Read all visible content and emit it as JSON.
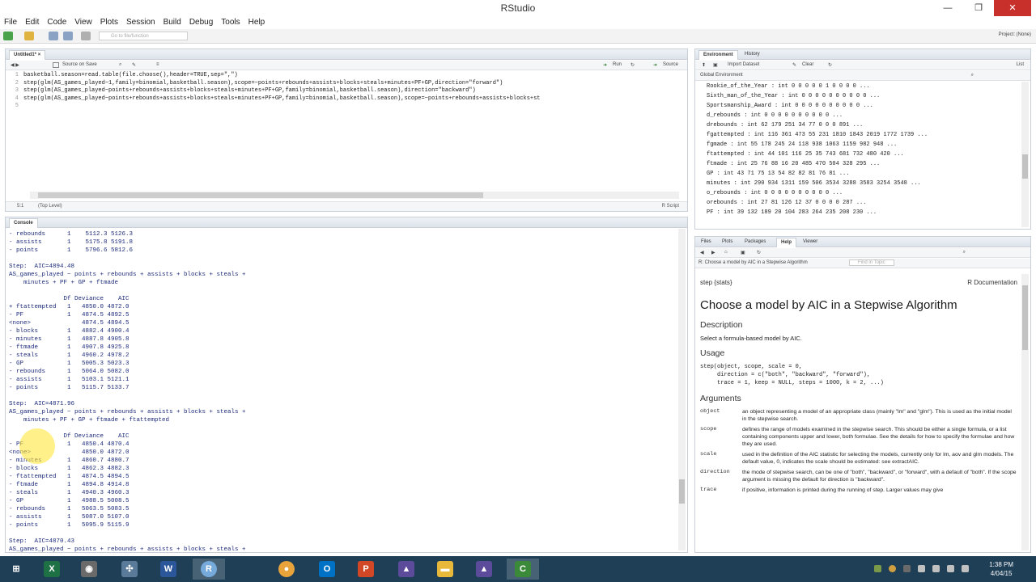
{
  "window": {
    "title": "RStudio",
    "minimize": "—",
    "maximize": "❐",
    "close": "✕"
  },
  "menu": [
    "File",
    "Edit",
    "Code",
    "View",
    "Plots",
    "Session",
    "Build",
    "Debug",
    "Tools",
    "Help"
  ],
  "toolbar": {
    "goto_placeholder": "Go to file/function",
    "project": "Project: (None)"
  },
  "editor": {
    "tab_label": "Untitled1*",
    "source_on_save": "Source on Save",
    "run_label": "Run",
    "source_label": "Source",
    "lines": [
      {
        "n": "1",
        "code": "basketball.season=read.table(file.choose(),header=TRUE,sep=\",\")"
      },
      {
        "n": "2",
        "code": "step(glm(AS_games_played~1,family=binomial,basketball.season),scope=~points+rebounds+assists+blocks+steals+minutes+PF+GP,direction=\"forward\")"
      },
      {
        "n": "3",
        "code": "step(glm(AS_games_played~points+rebounds+assists+blocks+steals+minutes+PF+GP,family=binomial,basketball.season),direction=\"backward\")"
      },
      {
        "n": "4",
        "code": "step(glm(AS_games_played~points+rebounds+assists+blocks+steals+minutes+PF+GP,family=binomial,basketball.season),scope=~points+rebounds+assists+blocks+st"
      },
      {
        "n": "5",
        "code": ""
      }
    ],
    "status_pos": "5:1",
    "status_level": "(Top Level)",
    "status_type": "R Script"
  },
  "console": {
    "tab_label": "Console",
    "lines": [
      "- rebounds      1    5112.3 5126.3",
      "- assists       1    5175.8 5191.8",
      "- points        1    5796.6 5812.6",
      "",
      "Step:  AIC=4894.48",
      "AS_games_played ~ points + rebounds + assists + blocks + steals +",
      "    minutes + PF + GP + ftmade",
      "",
      "               Df Deviance    AIC",
      "+ ftattempted   1   4850.0 4872.0",
      "- PF            1   4874.5 4892.5",
      "<none>              4874.5 4894.5",
      "- blocks        1   4882.4 4900.4",
      "- minutes       1   4887.8 4905.8",
      "- ftmade        1   4907.8 4925.8",
      "- steals        1   4960.2 4978.2",
      "- GP            1   5005.3 5023.3",
      "- rebounds      1   5064.0 5082.0",
      "- assists       1   5103.1 5121.1",
      "- points        1   5115.7 5133.7",
      "",
      "Step:  AIC=4871.96",
      "AS_games_played ~ points + rebounds + assists + blocks + steals +",
      "    minutes + PF + GP + ftmade + ftattempted",
      "",
      "               Df Deviance    AIC",
      "- PF            1   4850.4 4870.4",
      "<none>              4850.0 4872.0",
      "- minutes       1   4860.7 4880.7",
      "- blocks        1   4862.3 4882.3",
      "- ftattempted   1   4874.5 4894.5",
      "- ftmade        1   4894.8 4914.8",
      "- steals        1   4940.3 4960.3",
      "- GP            1   4988.5 5008.5",
      "- rebounds      1   5063.5 5083.5",
      "- assists       1   5087.0 5107.0",
      "- points        1   5095.9 5115.9",
      "",
      "Step:  AIC=4870.43",
      "AS_games_played ~ points + rebounds + assists + blocks + steals +"
    ]
  },
  "environment": {
    "tabs": [
      "Environment",
      "History"
    ],
    "import_label": "Import Dataset",
    "clear_label": "Clear",
    "list_label": "List",
    "scope": "Global Environment",
    "lines": [
      "Rookie_of_the_Year : int 0 0 0 0 0 1 0 0 0 0 ...",
      "Sixth_man_of_the_Year : int 0 0 0 0 0 0 0 0 0 0 ...",
      "Sportsmanship_Award : int 0 0 0 0 0 0 0 0 0 0 ...",
      "d_rebounds : int 0 0 0 0 0 0 0 0 0 0 ...",
      "drebounds : int 62 179 251 34 77 0 0 0 891 ...",
      "fgattempted : int 116 361 473 55 231 1810 1843 2019 1772 1739 ...",
      "fgmade : int 55 178 245 24 118 938 1063 1159 982 948 ...",
      "ftattempted : int 44 101 116 25 35 743 681 732 480 420 ...",
      "ftmade : int 25 76 88 16 20 485 470 504 328 295 ...",
      "GP : int 43 71 75 13 54 82 82 81 76 81 ...",
      "minutes : int 290 934 1311 159 506 3534 3288 3583 3254 3548 ...",
      "o_rebounds : int 0 0 0 0 0 0 0 0 0 0 ...",
      "orebounds : int 27 81 126 12 37 0 0 0 0 287 ...",
      "PF : int 39 132 189 20 104 283 264 235 208 230 ..."
    ]
  },
  "help": {
    "tabs": [
      "Files",
      "Plots",
      "Packages",
      "Help",
      "Viewer"
    ],
    "topic_bar": "R: Choose a model by AIC in a Stepwise Algorithm",
    "search_placeholder": "Find in Topic",
    "page_id": "step {stats}",
    "page_source": "R Documentation",
    "title": "Choose a model by AIC in a Stepwise Algorithm",
    "description_head": "Description",
    "description": "Select a formula-based model by AIC.",
    "usage_head": "Usage",
    "usage": "step(object, scope, scale = 0,\n     direction = c(\"both\", \"backward\", \"forward\"),\n     trace = 1, keep = NULL, steps = 1000, k = 2, ...)",
    "arguments_head": "Arguments",
    "arguments": [
      {
        "name": "object",
        "desc": "an object representing a model of an appropriate class (mainly \"lm\" and \"glm\"). This is used as the initial model in the stepwise search."
      },
      {
        "name": "scope",
        "desc": "defines the range of models examined in the stepwise search. This should be either a single formula, or a list containing components upper and lower, both formulae. See the details for how to specify the formulae and how they are used."
      },
      {
        "name": "scale",
        "desc": "used in the definition of the AIC statistic for selecting the models, currently only for lm, aov and glm models. The default value, 0, indicates the scale should be estimated: see extractAIC."
      },
      {
        "name": "direction",
        "desc": "the mode of stepwise search, can be one of \"both\", \"backward\", or \"forward\", with a default of \"both\". If the scope argument is missing the default for direction is \"backward\"."
      },
      {
        "name": "trace",
        "desc": "if positive, information is printed during the running of step. Larger values may give"
      }
    ]
  },
  "taskbar": {
    "apps": [
      "Excel",
      "Browser",
      "Network",
      "Word",
      "RStudio",
      "Chrome",
      "Outlook",
      "PowerPoint",
      "Mountain",
      "Folder",
      "Mountain2",
      "Camtasia"
    ],
    "time": "1:38 PM",
    "date": "4/04/15"
  },
  "colors": {
    "console_text": "#1c2a7a",
    "taskbar": "#1f3f57",
    "close": "#c7302b"
  }
}
